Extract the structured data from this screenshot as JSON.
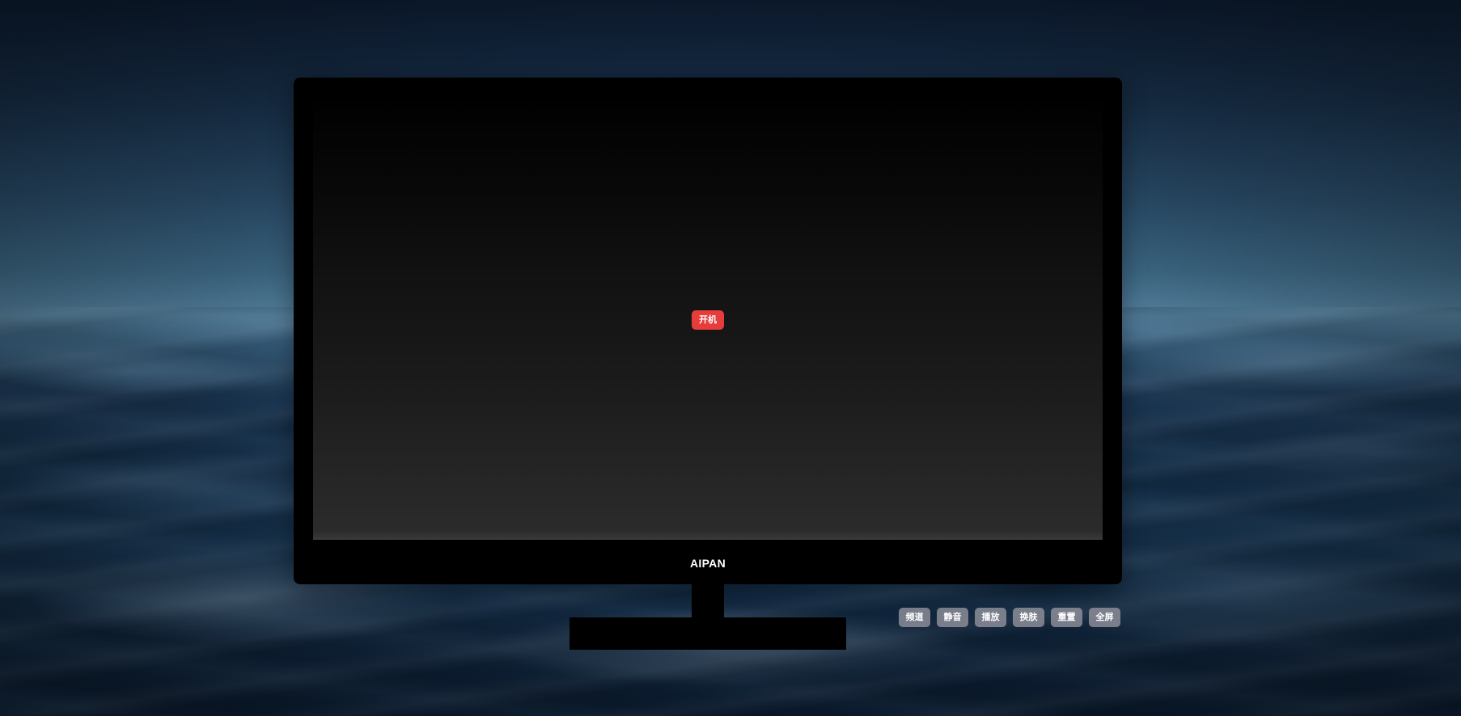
{
  "monitor": {
    "brand": "AIPAN",
    "power_button_label": "开机"
  },
  "controls": [
    {
      "id": "channel",
      "label": "频道"
    },
    {
      "id": "mute",
      "label": "静音"
    },
    {
      "id": "play",
      "label": "播放"
    },
    {
      "id": "skin",
      "label": "换肤"
    },
    {
      "id": "reset",
      "label": "重置"
    },
    {
      "id": "fullscreen",
      "label": "全屏"
    }
  ],
  "colors": {
    "power_button": "#e63c3c",
    "control_button": "#9696a0",
    "monitor_body": "#000000"
  }
}
